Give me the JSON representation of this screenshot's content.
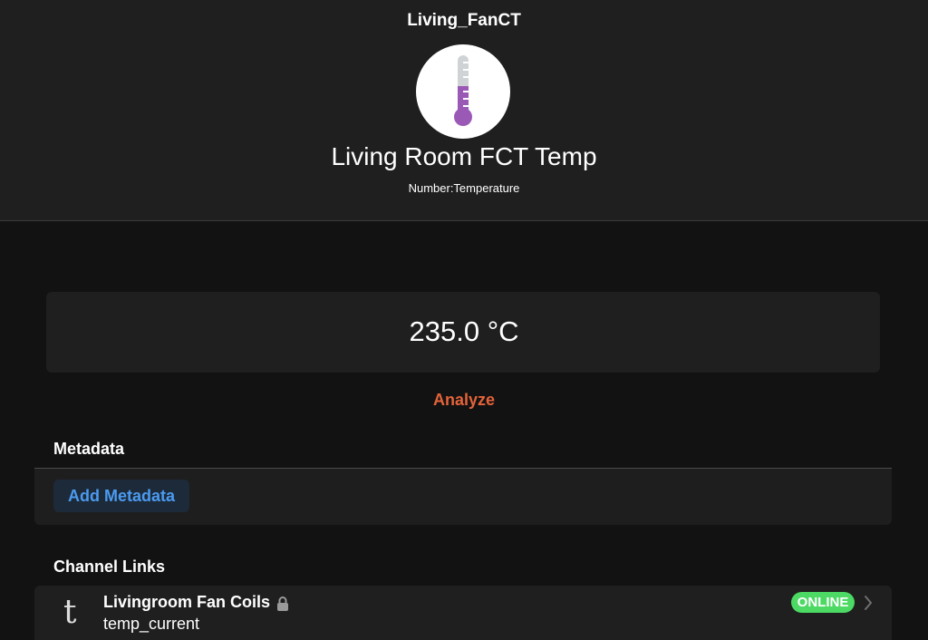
{
  "header": {
    "item_name": "Living_FanCT",
    "item_label": "Living Room FCT Temp",
    "item_type": "Number:Temperature",
    "icon": "thermometer-icon"
  },
  "state": {
    "value": "235.0 °C"
  },
  "actions": {
    "analyze_label": "Analyze"
  },
  "metadata": {
    "title": "Metadata",
    "add_label": "Add Metadata"
  },
  "channel_links": {
    "title": "Channel Links",
    "items": [
      {
        "glyph": "t",
        "name": "Livingroom Fan Coils",
        "channel": "temp_current",
        "status": "ONLINE",
        "locked": true
      }
    ]
  },
  "colors": {
    "accent_analyze": "#e4633a",
    "link_blue": "#4a9bf0",
    "status_online": "#4cd964",
    "thermometer_purple": "#9b59b6"
  }
}
